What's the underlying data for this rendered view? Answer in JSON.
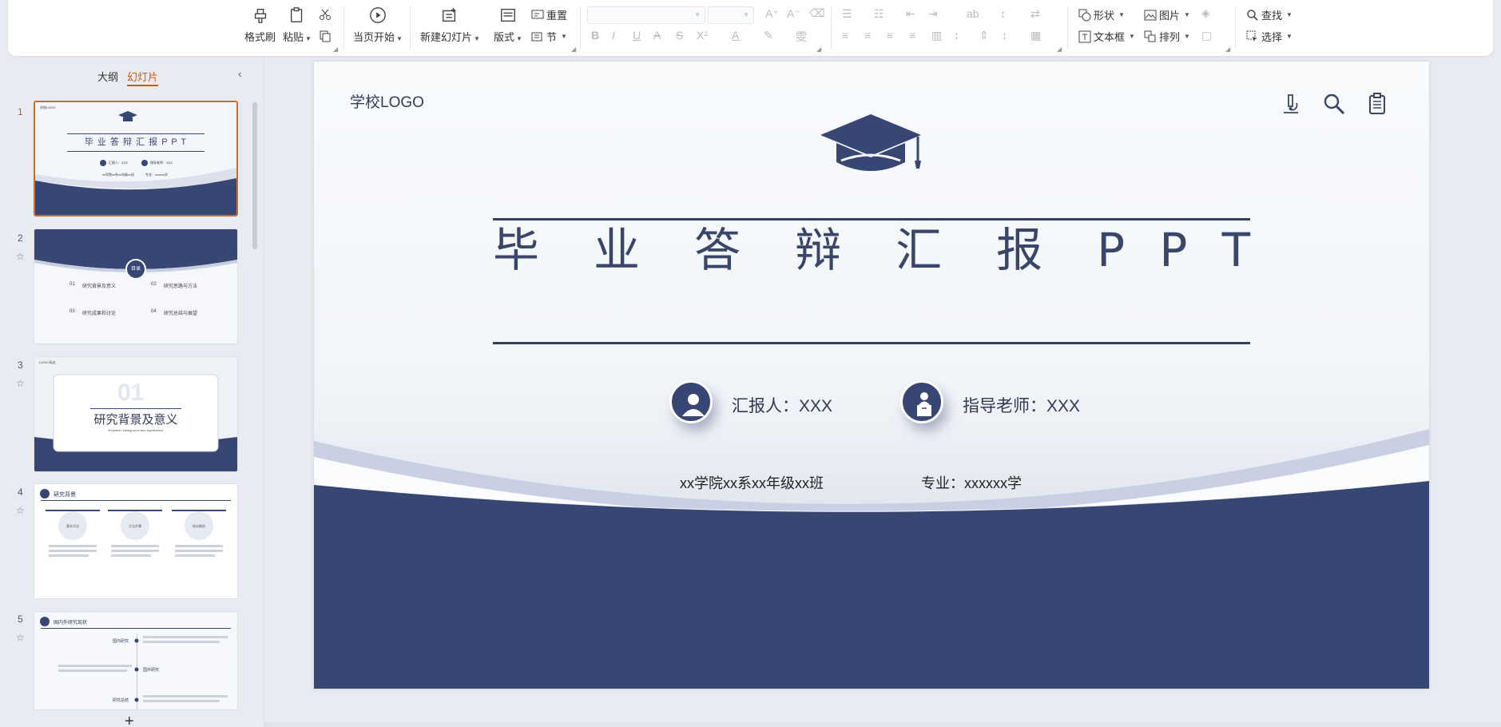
{
  "ribbon": {
    "format_painter": "格式刷",
    "paste": "粘贴",
    "from_current": "当页开始",
    "new_slide": "新建幻灯片",
    "layout": "版式",
    "reset": "重置",
    "section": "节",
    "shape": "形状",
    "picture": "图片",
    "textbox": "文本框",
    "arrange": "排列",
    "find": "查找",
    "select": "选择"
  },
  "panel": {
    "tab_outline": "大纲",
    "tab_slides": "幻灯片",
    "slide_numbers": [
      "1",
      "2",
      "3",
      "4",
      "5"
    ]
  },
  "thumbs": {
    "t1": {
      "logo": "学校LOGO",
      "title": "毕 业 答 辩 汇 报 P P T",
      "reporter": "汇报人：XXX",
      "advisor": "指导老师：XXX",
      "dept": "xx学院xx系xx年级xx班",
      "major": "专业：xxxxxx学"
    },
    "t2": {
      "center": "目录",
      "items": [
        "01",
        "研究背景及意义",
        "02",
        "研究思路与方法",
        "03",
        "研究成果和讨论",
        "04",
        "研究总结与展望"
      ]
    },
    "t3": {
      "logo": "LOGO 标志",
      "num": "01",
      "title": "研究背景及意义",
      "sub": "Research background and significance"
    },
    "t4": {
      "title": "研究背景",
      "c1": "基本方法",
      "c2": "方法步骤",
      "c3": "结论概述"
    },
    "t5": {
      "title": "国内外研究现状",
      "r1": "国内研究",
      "r2": "国外研究",
      "r3": "研究总结"
    }
  },
  "slide": {
    "logo": "学校LOGO",
    "title": "毕 业 答 辩 汇 报 P P T",
    "reporter": "汇报人：XXX",
    "advisor": "指导老师：XXX",
    "dept": "xx学院xx系xx年级xx班",
    "major": "专业：xxxxxx学",
    "colors": {
      "navy": "#384673",
      "accent": "#c85a16"
    }
  }
}
